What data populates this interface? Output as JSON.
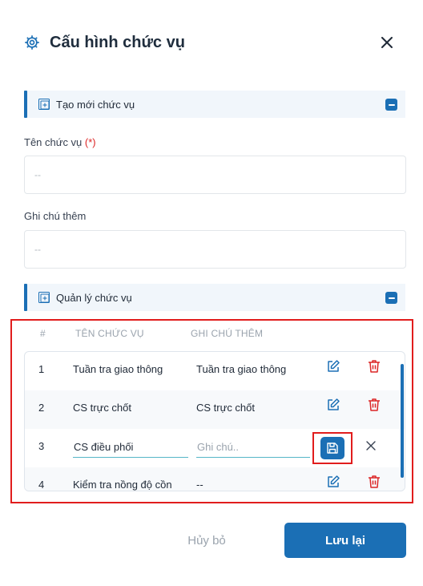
{
  "dialog": {
    "title": "Cấu hình chức vụ",
    "icon": "gear-icon",
    "close_icon": "close-icon"
  },
  "create_section": {
    "label": "Tạo mới chức vụ",
    "name_label": "Tên chức vụ",
    "required_mark": "(*)",
    "name_placeholder": "--",
    "note_label": "Ghi chú thêm",
    "note_placeholder": "--"
  },
  "manage_section": {
    "label": "Quản lý chức vụ",
    "columns": [
      "#",
      "TÊN CHỨC VỤ",
      "GHI CHÚ THÊM"
    ],
    "rows": [
      {
        "num": "1",
        "name": "Tuần tra giao thông",
        "note": "Tuần tra giao thông"
      },
      {
        "num": "2",
        "name": "CS trực chốt",
        "note": "CS trực chốt"
      },
      {
        "num": "3",
        "name_value": "CS điều phối",
        "note_placeholder": "Ghi chú.."
      },
      {
        "num": "4",
        "name": "Kiểm tra nồng độ cồn",
        "note": "--"
      }
    ]
  },
  "footer": {
    "cancel_label": "Hủy bỏ",
    "save_label": "Lưu lại"
  },
  "colors": {
    "primary": "#1b6fb5",
    "danger": "#dc2626",
    "highlight": "#e11d1d"
  }
}
